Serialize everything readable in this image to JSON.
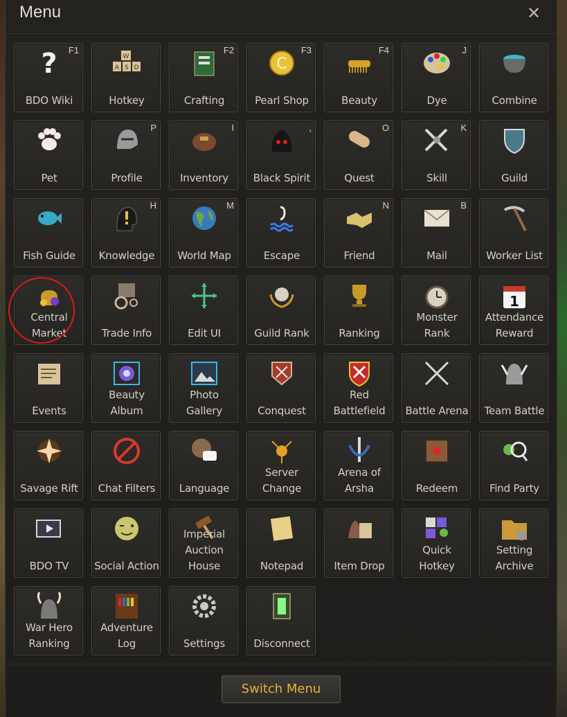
{
  "window": {
    "title": "Menu",
    "close_label": "✕"
  },
  "footer": {
    "switch_label": "Switch Menu"
  },
  "accent": {
    "gold": "#e8b23a",
    "annotation_red": "#e01818"
  },
  "tiles": [
    {
      "id": "bdo-wiki",
      "label": "BDO Wiki",
      "hotkey": "F1",
      "icon": "question-icon"
    },
    {
      "id": "hotkey",
      "label": "Hotkey",
      "hotkey": "",
      "icon": "keyboard-icon"
    },
    {
      "id": "crafting",
      "label": "Crafting",
      "hotkey": "F2",
      "icon": "crafting-book-icon"
    },
    {
      "id": "pearl-shop",
      "label": "Pearl Shop",
      "hotkey": "F3",
      "icon": "pearl-coin-icon"
    },
    {
      "id": "beauty",
      "label": "Beauty",
      "hotkey": "F4",
      "icon": "comb-icon"
    },
    {
      "id": "dye",
      "label": "Dye",
      "hotkey": "J",
      "icon": "palette-icon"
    },
    {
      "id": "combine",
      "label": "Combine",
      "hotkey": "",
      "icon": "cauldron-icon"
    },
    {
      "id": "pet",
      "label": "Pet",
      "hotkey": "",
      "icon": "paw-icon"
    },
    {
      "id": "profile",
      "label": "Profile",
      "hotkey": "P",
      "icon": "knight-helmet-icon"
    },
    {
      "id": "inventory",
      "label": "Inventory",
      "hotkey": "I",
      "icon": "bag-icon"
    },
    {
      "id": "black-spirit",
      "label": "Black Spirit",
      "hotkey": ",",
      "icon": "black-spirit-icon"
    },
    {
      "id": "quest",
      "label": "Quest",
      "hotkey": "O",
      "icon": "scroll-icon"
    },
    {
      "id": "skill",
      "label": "Skill",
      "hotkey": "K",
      "icon": "crossed-swords-icon"
    },
    {
      "id": "guild",
      "label": "Guild",
      "hotkey": "",
      "icon": "guild-shield-icon"
    },
    {
      "id": "fish-guide",
      "label": "Fish Guide",
      "hotkey": "",
      "icon": "fish-icon"
    },
    {
      "id": "knowledge",
      "label": "Knowledge",
      "hotkey": "H",
      "icon": "head-exclamation-icon"
    },
    {
      "id": "world-map",
      "label": "World Map",
      "hotkey": "M",
      "icon": "globe-icon"
    },
    {
      "id": "escape",
      "label": "Escape",
      "hotkey": "",
      "icon": "escape-wave-icon"
    },
    {
      "id": "friend",
      "label": "Friend",
      "hotkey": "N",
      "icon": "handshake-icon"
    },
    {
      "id": "mail",
      "label": "Mail",
      "hotkey": "B",
      "icon": "envelope-icon"
    },
    {
      "id": "worker-list",
      "label": "Worker List",
      "hotkey": "",
      "icon": "pickaxe-icon"
    },
    {
      "id": "central-market",
      "label": "Central",
      "label2": "Market",
      "hotkey": "",
      "icon": "money-bag-icon"
    },
    {
      "id": "trade-info",
      "label": "Trade Info",
      "hotkey": "",
      "icon": "wagon-icon"
    },
    {
      "id": "edit-ui",
      "label": "Edit UI",
      "hotkey": "",
      "icon": "move-arrows-icon"
    },
    {
      "id": "guild-rank",
      "label": "Guild Rank",
      "hotkey": "",
      "icon": "laurel-crown-icon"
    },
    {
      "id": "ranking",
      "label": "Ranking",
      "hotkey": "",
      "icon": "trophy-icon"
    },
    {
      "id": "monster-rank",
      "label": "Monster",
      "label2": "Rank",
      "hotkey": "",
      "icon": "clock-icon"
    },
    {
      "id": "attendance-reward",
      "label": "Attendance",
      "label2": "Reward",
      "hotkey": "",
      "icon": "calendar-icon"
    },
    {
      "id": "events",
      "label": "Events",
      "hotkey": "",
      "icon": "notice-board-icon"
    },
    {
      "id": "beauty-album",
      "label": "Beauty",
      "label2": "Album",
      "hotkey": "",
      "icon": "camera-lens-icon"
    },
    {
      "id": "photo-gallery",
      "label": "Photo",
      "label2": "Gallery",
      "hotkey": "",
      "icon": "photo-icon"
    },
    {
      "id": "conquest",
      "label": "Conquest",
      "hotkey": "",
      "icon": "conquest-banner-icon"
    },
    {
      "id": "red-battlefield",
      "label": "Red",
      "label2": "Battlefield",
      "hotkey": "",
      "icon": "red-shield-icon"
    },
    {
      "id": "battle-arena",
      "label": "Battle Arena",
      "hotkey": "",
      "icon": "crossed-blades-icon"
    },
    {
      "id": "team-battle",
      "label": "Team Battle",
      "hotkey": "",
      "icon": "winged-helmet-icon"
    },
    {
      "id": "savage-rift",
      "label": "Savage Rift",
      "hotkey": "",
      "icon": "rift-burst-icon"
    },
    {
      "id": "chat-filters",
      "label": "Chat Filters",
      "hotkey": "",
      "icon": "chat-block-icon"
    },
    {
      "id": "language",
      "label": "Language",
      "hotkey": "",
      "icon": "language-globe-icon"
    },
    {
      "id": "server-change",
      "label": "Server",
      "label2": "Change",
      "hotkey": "",
      "icon": "server-node-icon"
    },
    {
      "id": "arena-of-arsha",
      "label": "Arena of",
      "label2": "Arsha",
      "hotkey": "",
      "icon": "arsha-sword-icon"
    },
    {
      "id": "redeem",
      "label": "Redeem",
      "hotkey": "",
      "icon": "coupon-box-icon"
    },
    {
      "id": "find-party",
      "label": "Find Party",
      "hotkey": "",
      "icon": "party-search-icon"
    },
    {
      "id": "bdo-tv",
      "label": "BDO TV",
      "hotkey": "",
      "icon": "tv-icon"
    },
    {
      "id": "social-action",
      "label": "Social Action",
      "hotkey": "",
      "icon": "wink-face-icon"
    },
    {
      "id": "imperial-auction-house",
      "label": "Imperial",
      "label2": "Auction",
      "label3": "House",
      "hotkey": "",
      "icon": "gavel-icon"
    },
    {
      "id": "notepad",
      "label": "Notepad",
      "hotkey": "",
      "icon": "notepad-icon"
    },
    {
      "id": "item-drop",
      "label": "Item Drop",
      "hotkey": "",
      "icon": "item-drop-icon"
    },
    {
      "id": "quick-hotkey",
      "label": "Quick",
      "label2": "Hotkey",
      "hotkey": "",
      "icon": "quick-slots-icon"
    },
    {
      "id": "setting-archive",
      "label": "Setting",
      "label2": "Archive",
      "hotkey": "",
      "icon": "folder-gear-icon"
    },
    {
      "id": "war-hero-ranking",
      "label": "War Hero",
      "label2": "Ranking",
      "hotkey": "",
      "icon": "horned-helmet-icon"
    },
    {
      "id": "adventure-log",
      "label": "Adventure",
      "label2": "Log",
      "hotkey": "",
      "icon": "bookshelf-icon"
    },
    {
      "id": "settings",
      "label": "Settings",
      "hotkey": "",
      "icon": "gear-icon"
    },
    {
      "id": "disconnect",
      "label": "Disconnect",
      "hotkey": "",
      "icon": "door-exit-icon"
    }
  ]
}
